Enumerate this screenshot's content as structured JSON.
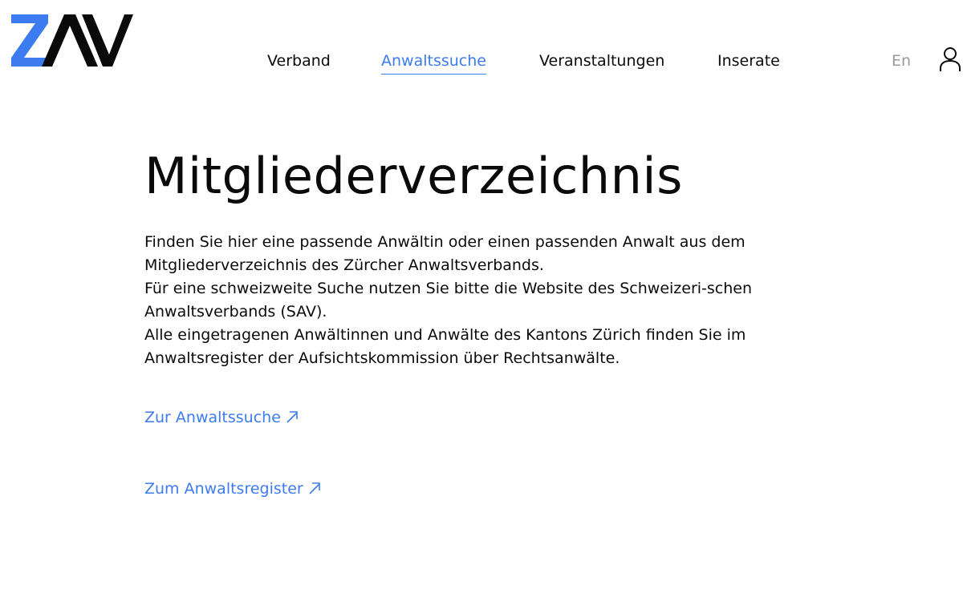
{
  "header": {
    "logo": "ZAV",
    "nav": [
      {
        "label": "Verband",
        "active": false
      },
      {
        "label": "Anwaltssuche",
        "active": true
      },
      {
        "label": "Veranstaltungen",
        "active": false
      },
      {
        "label": "Inserate",
        "active": false
      }
    ],
    "language": "En",
    "user_icon": "user-icon"
  },
  "main": {
    "title": "Mitgliederverzeichnis",
    "paragraphs": [
      "Finden Sie hier eine passende Anwältin oder einen passenden Anwalt aus dem Mitgliederverzeichnis des Zürcher Anwaltsverbands.",
      "Für eine schweizweite Suche nutzen Sie bitte die Website des Schweizeri-schen Anwaltsverbands (SAV).",
      "Alle eingetragenen Anwältinnen und Anwälte des Kantons Zürich finden Sie im Anwaltsregister der Aufsichtskommission über Rechtsanwälte."
    ],
    "links": [
      {
        "label": "Zur Anwaltssuche",
        "icon": "external-arrow-icon"
      },
      {
        "label": "Zum Anwaltsregister",
        "icon": "external-arrow-icon"
      }
    ]
  },
  "colors": {
    "accent": "#3d7bf0",
    "text": "#0a0a0a",
    "muted": "#9a9a9a",
    "logo_blue": "#3d7bf0"
  }
}
